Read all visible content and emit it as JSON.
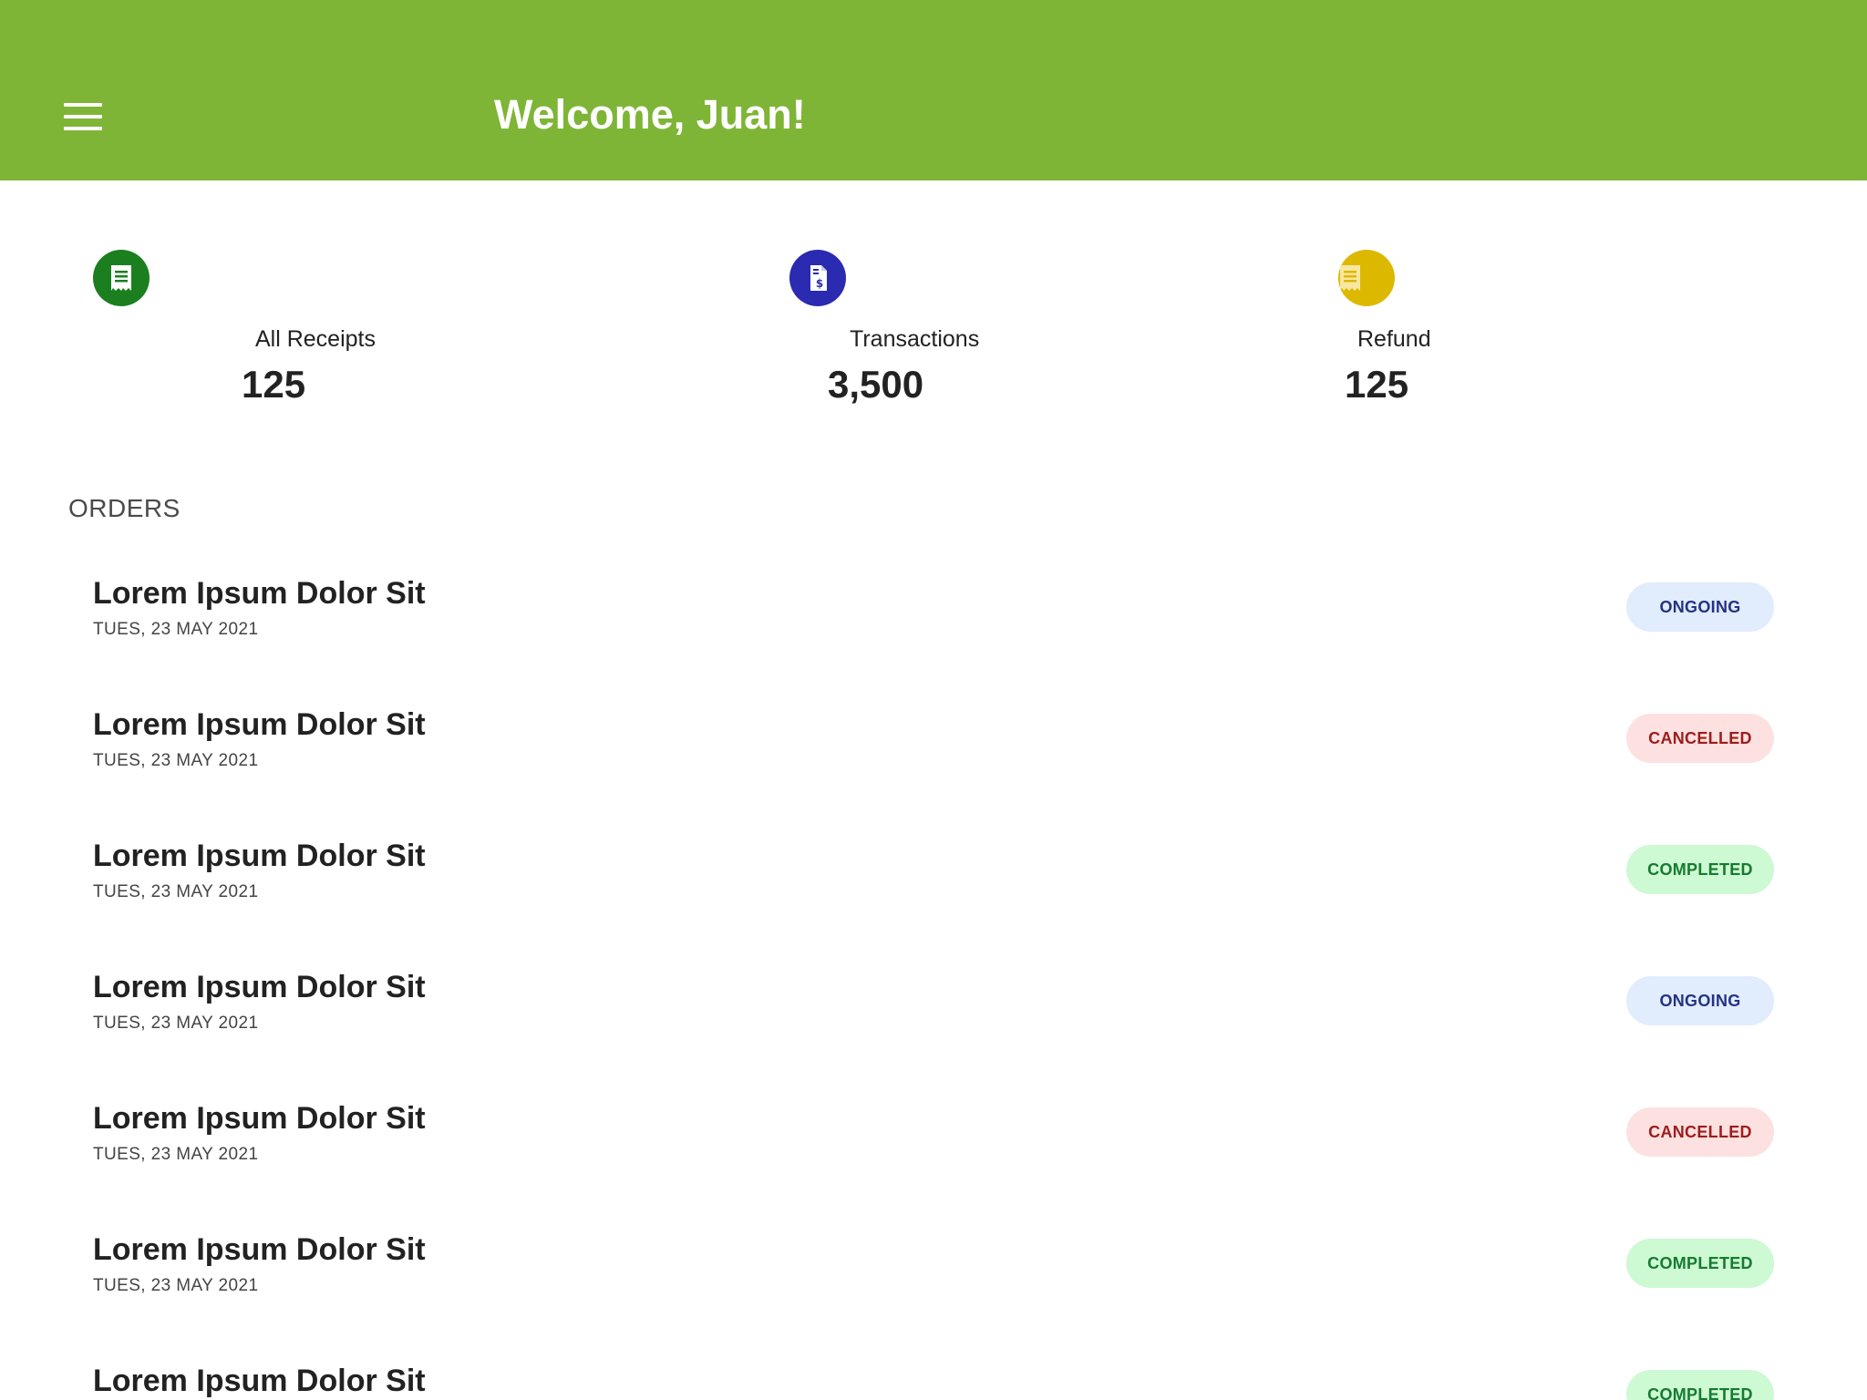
{
  "header": {
    "title": "Welcome, Juan!",
    "background": "#7fb536",
    "menu_icon": "hamburger-menu-icon"
  },
  "stats": [
    {
      "label": "All Receipts",
      "value": "125",
      "icon": "receipt-icon",
      "color": "#1b7f1f"
    },
    {
      "label": "Transactions",
      "value": "3,500",
      "icon": "invoice-dollar-icon",
      "color": "#2a2bb0"
    },
    {
      "label": "Refund",
      "value": "125",
      "icon": "receipt-icon",
      "color": "#ddb800"
    }
  ],
  "orders_section": {
    "title": "ORDERS"
  },
  "orders": [
    {
      "title": "Lorem Ipsum Dolor Sit",
      "date": "TUES, 23 MAY 2021",
      "status": "ONGOING",
      "status_key": "ongoing"
    },
    {
      "title": "Lorem Ipsum Dolor Sit",
      "date": "TUES, 23 MAY 2021",
      "status": "CANCELLED",
      "status_key": "cancelled"
    },
    {
      "title": "Lorem Ipsum Dolor Sit",
      "date": "TUES, 23 MAY 2021",
      "status": "COMPLETED",
      "status_key": "completed"
    },
    {
      "title": "Lorem Ipsum Dolor Sit",
      "date": "TUES, 23 MAY 2021",
      "status": "ONGOING",
      "status_key": "ongoing"
    },
    {
      "title": "Lorem Ipsum Dolor Sit",
      "date": "TUES, 23 MAY 2021",
      "status": "CANCELLED",
      "status_key": "cancelled"
    },
    {
      "title": "Lorem Ipsum Dolor Sit",
      "date": "TUES, 23 MAY 2021",
      "status": "COMPLETED",
      "status_key": "completed"
    },
    {
      "title": "Lorem Ipsum Dolor Sit",
      "date": "",
      "status": "COMPLETED",
      "status_key": "completed"
    }
  ],
  "status_colors": {
    "ongoing": {
      "bg": "#e1ecfd",
      "fg": "#253282"
    },
    "cancelled": {
      "bg": "#fde1e1",
      "fg": "#9e1c1c"
    },
    "completed": {
      "bg": "#cdf9d3",
      "fg": "#167a30"
    }
  }
}
